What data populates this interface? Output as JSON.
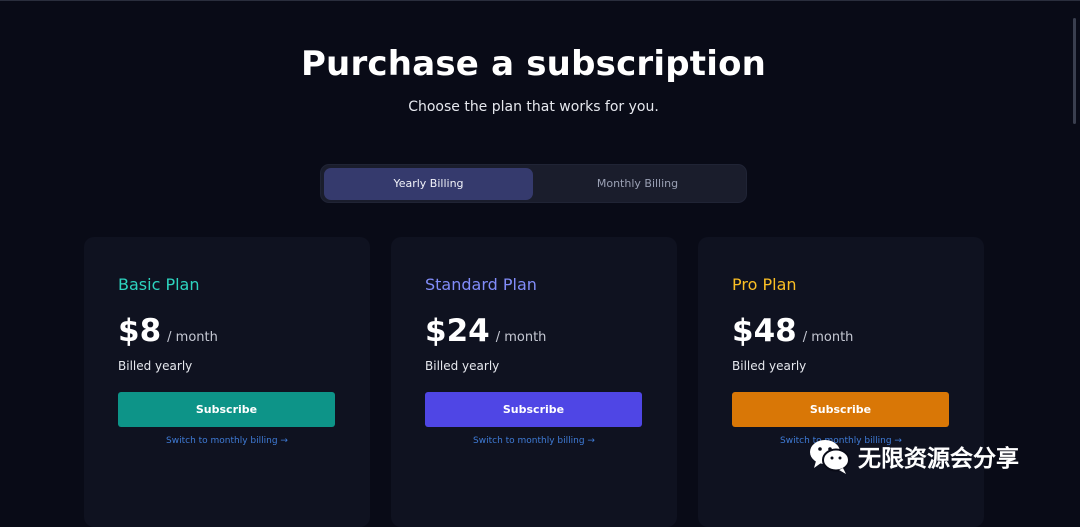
{
  "header": {
    "title": "Purchase a subscription",
    "subtitle": "Choose the plan that works for you."
  },
  "billing_toggle": {
    "yearly_label": "Yearly Billing",
    "monthly_label": "Monthly Billing",
    "selected": "yearly"
  },
  "plans": [
    {
      "name": "Basic Plan",
      "price": "$8",
      "period": "/ month",
      "billed": "Billed yearly",
      "button": "Subscribe",
      "switch_link": "Switch to monthly billing →",
      "accent": "#2dd4bf",
      "button_color": "#0d9488"
    },
    {
      "name": "Standard Plan",
      "price": "$24",
      "period": "/ month",
      "billed": "Billed yearly",
      "button": "Subscribe",
      "switch_link": "Switch to monthly billing →",
      "accent": "#818cf8",
      "button_color": "#4f46e5"
    },
    {
      "name": "Pro Plan",
      "price": "$48",
      "period": "/ month",
      "billed": "Billed yearly",
      "button": "Subscribe",
      "switch_link": "Switch to monthly billing →",
      "accent": "#fbbf24",
      "button_color": "#d97706"
    }
  ],
  "watermark": {
    "text": "无限资源会分享",
    "icon": "wechat-icon"
  },
  "colors": {
    "background": "#090b17",
    "card": "#0f1220",
    "toggle_active": "#353a6d",
    "link": "#3f7bd6"
  }
}
